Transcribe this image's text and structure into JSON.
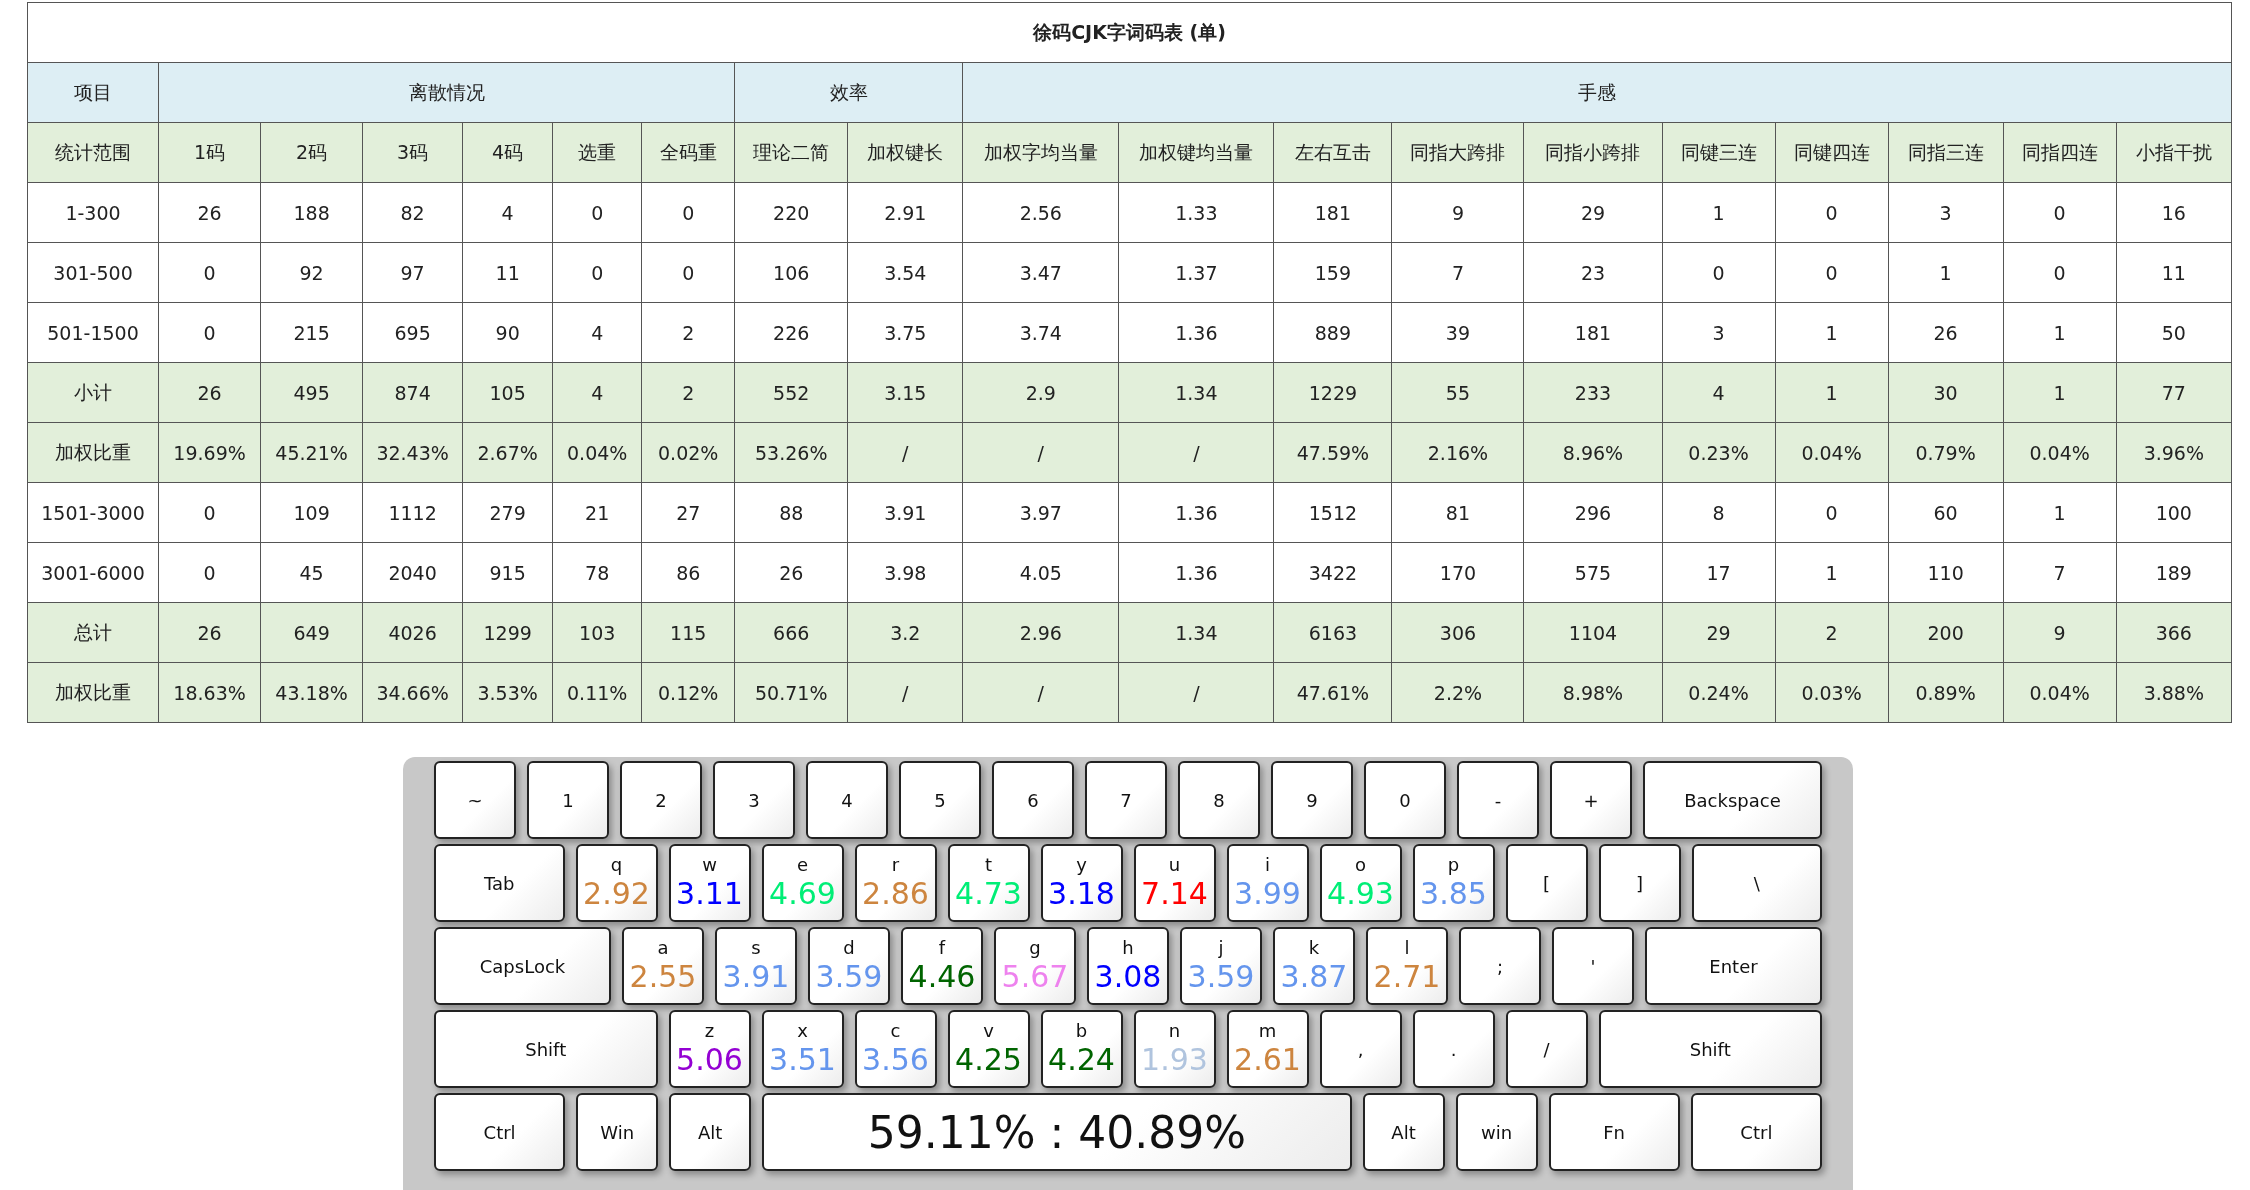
{
  "table": {
    "title": "徐码CJK字词码表 (单)",
    "group_headers": [
      "项目",
      "离散情况",
      "效率",
      "手感"
    ],
    "columns": [
      "统计范围",
      "1码",
      "2码",
      "3码",
      "4码",
      "选重",
      "全码重",
      "理论二简",
      "加权键长",
      "加权字均当量",
      "加权键均当量",
      "左右互击",
      "同指大跨排",
      "同指小跨排",
      "同键三连",
      "同键四连",
      "同指三连",
      "同指四连",
      "小指干扰"
    ],
    "rows": [
      {
        "kind": "data",
        "cells": [
          "1-300",
          "26",
          "188",
          "82",
          "4",
          "0",
          "0",
          "220",
          "2.91",
          "2.56",
          "1.33",
          "181",
          "9",
          "29",
          "1",
          "0",
          "3",
          "0",
          "16"
        ]
      },
      {
        "kind": "data",
        "cells": [
          "301-500",
          "0",
          "92",
          "97",
          "11",
          "0",
          "0",
          "106",
          "3.54",
          "3.47",
          "1.37",
          "159",
          "7",
          "23",
          "0",
          "0",
          "1",
          "0",
          "11"
        ]
      },
      {
        "kind": "data",
        "cells": [
          "501-1500",
          "0",
          "215",
          "695",
          "90",
          "4",
          "2",
          "226",
          "3.75",
          "3.74",
          "1.36",
          "889",
          "39",
          "181",
          "3",
          "1",
          "26",
          "1",
          "50"
        ]
      },
      {
        "kind": "summary",
        "cells": [
          "小计",
          "26",
          "495",
          "874",
          "105",
          "4",
          "2",
          "552",
          "3.15",
          "2.9",
          "1.34",
          "1229",
          "55",
          "233",
          "4",
          "1",
          "30",
          "1",
          "77"
        ]
      },
      {
        "kind": "summary",
        "cells": [
          "加权比重",
          "19.69%",
          "45.21%",
          "32.43%",
          "2.67%",
          "0.04%",
          "0.02%",
          "53.26%",
          "/",
          "/",
          "/",
          "47.59%",
          "2.16%",
          "8.96%",
          "0.23%",
          "0.04%",
          "0.79%",
          "0.04%",
          "3.96%"
        ]
      },
      {
        "kind": "data",
        "cells": [
          "1501-3000",
          "0",
          "109",
          "1112",
          "279",
          "21",
          "27",
          "88",
          "3.91",
          "3.97",
          "1.36",
          "1512",
          "81",
          "296",
          "8",
          "0",
          "60",
          "1",
          "100"
        ]
      },
      {
        "kind": "data",
        "cells": [
          "3001-6000",
          "0",
          "45",
          "2040",
          "915",
          "78",
          "86",
          "26",
          "3.98",
          "4.05",
          "1.36",
          "3422",
          "170",
          "575",
          "17",
          "1",
          "110",
          "7",
          "189"
        ]
      },
      {
        "kind": "summary",
        "cells": [
          "总计",
          "26",
          "649",
          "4026",
          "1299",
          "103",
          "115",
          "666",
          "3.2",
          "2.96",
          "1.34",
          "6163",
          "306",
          "1104",
          "29",
          "2",
          "200",
          "9",
          "366"
        ]
      },
      {
        "kind": "summary",
        "cells": [
          "加权比重",
          "18.63%",
          "43.18%",
          "34.66%",
          "3.53%",
          "0.11%",
          "0.12%",
          "50.71%",
          "/",
          "/",
          "/",
          "47.61%",
          "2.2%",
          "8.98%",
          "0.24%",
          "0.03%",
          "0.89%",
          "0.04%",
          "3.88%"
        ]
      }
    ]
  },
  "keyboard": {
    "number_row": [
      {
        "kind": "unit",
        "label": "~"
      },
      {
        "kind": "unit",
        "label": "1"
      },
      {
        "kind": "unit",
        "label": "2"
      },
      {
        "kind": "unit",
        "label": "3"
      },
      {
        "kind": "unit",
        "label": "4"
      },
      {
        "kind": "unit",
        "label": "5"
      },
      {
        "kind": "unit",
        "label": "6"
      },
      {
        "kind": "unit",
        "label": "7"
      },
      {
        "kind": "unit",
        "label": "8"
      },
      {
        "kind": "unit",
        "label": "9"
      },
      {
        "kind": "unit",
        "label": "0"
      },
      {
        "kind": "unit",
        "label": "-"
      },
      {
        "kind": "unit",
        "label": "+"
      },
      {
        "kind": "wide",
        "label": "Backspace"
      }
    ],
    "top_row": [
      {
        "kind": "wide",
        "label": "Tab"
      },
      {
        "kind": "letter",
        "label": "q",
        "value": "2.92",
        "color": "#cd853f"
      },
      {
        "kind": "letter",
        "label": "w",
        "value": "3.11",
        "color": "#0000ff"
      },
      {
        "kind": "letter",
        "label": "e",
        "value": "4.69",
        "color": "#00ee76"
      },
      {
        "kind": "letter",
        "label": "r",
        "value": "2.86",
        "color": "#cd853f"
      },
      {
        "kind": "letter",
        "label": "t",
        "value": "4.73",
        "color": "#00ee76"
      },
      {
        "kind": "letter",
        "label": "y",
        "value": "3.18",
        "color": "#0000ff"
      },
      {
        "kind": "letter",
        "label": "u",
        "value": "7.14",
        "color": "#ff0000"
      },
      {
        "kind": "letter",
        "label": "i",
        "value": "3.99",
        "color": "#6495ed"
      },
      {
        "kind": "letter",
        "label": "o",
        "value": "4.93",
        "color": "#00ee76"
      },
      {
        "kind": "letter",
        "label": "p",
        "value": "3.85",
        "color": "#6495ed"
      },
      {
        "kind": "unit",
        "label": "["
      },
      {
        "kind": "unit",
        "label": "]"
      },
      {
        "kind": "wide",
        "label": "\\"
      }
    ],
    "home_row": [
      {
        "kind": "wide",
        "label": "CapsLock"
      },
      {
        "kind": "letter",
        "label": "a",
        "value": "2.55",
        "color": "#cd853f"
      },
      {
        "kind": "letter",
        "label": "s",
        "value": "3.91",
        "color": "#6495ed"
      },
      {
        "kind": "letter",
        "label": "d",
        "value": "3.59",
        "color": "#6495ed"
      },
      {
        "kind": "letter",
        "label": "f",
        "value": "4.46",
        "color": "#006400"
      },
      {
        "kind": "letter",
        "label": "g",
        "value": "5.67",
        "color": "#ee82ee"
      },
      {
        "kind": "letter",
        "label": "h",
        "value": "3.08",
        "color": "#0000ff"
      },
      {
        "kind": "letter",
        "label": "j",
        "value": "3.59",
        "color": "#6495ed"
      },
      {
        "kind": "letter",
        "label": "k",
        "value": "3.87",
        "color": "#6495ed"
      },
      {
        "kind": "letter",
        "label": "l",
        "value": "2.71",
        "color": "#cd853f"
      },
      {
        "kind": "unit",
        "label": ";"
      },
      {
        "kind": "unit",
        "label": "'"
      },
      {
        "kind": "wide",
        "label": "Enter"
      }
    ],
    "bottom_row": [
      {
        "kind": "wide",
        "label": "Shift"
      },
      {
        "kind": "letter",
        "label": "z",
        "value": "5.06",
        "color": "#9400d3"
      },
      {
        "kind": "letter",
        "label": "x",
        "value": "3.51",
        "color": "#6495ed"
      },
      {
        "kind": "letter",
        "label": "c",
        "value": "3.56",
        "color": "#6495ed"
      },
      {
        "kind": "letter",
        "label": "v",
        "value": "4.25",
        "color": "#006400"
      },
      {
        "kind": "letter",
        "label": "b",
        "value": "4.24",
        "color": "#006400"
      },
      {
        "kind": "letter",
        "label": "n",
        "value": "1.93",
        "color": "#b0c4de"
      },
      {
        "kind": "letter",
        "label": "m",
        "value": "2.61",
        "color": "#cd853f"
      },
      {
        "kind": "unit",
        "label": ","
      },
      {
        "kind": "unit",
        "label": "."
      },
      {
        "kind": "unit",
        "label": "/"
      },
      {
        "kind": "wide",
        "label": "Shift"
      }
    ],
    "space_row": [
      {
        "kind": "wide",
        "label": "Ctrl"
      },
      {
        "kind": "unit",
        "label": "Win"
      },
      {
        "kind": "unit",
        "label": "Alt"
      },
      {
        "kind": "space",
        "label": "59.11% : 40.89%"
      },
      {
        "kind": "unit",
        "label": "Alt"
      },
      {
        "kind": "unit",
        "label": "win"
      },
      {
        "kind": "wide",
        "label": "Fn"
      },
      {
        "kind": "wide",
        "label": "Ctrl"
      }
    ]
  }
}
